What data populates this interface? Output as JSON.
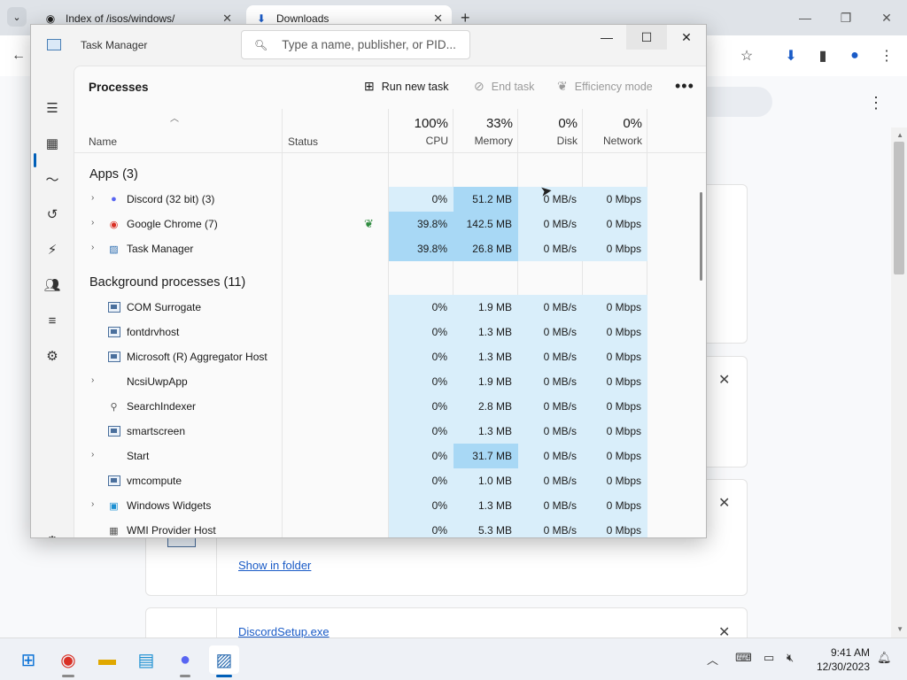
{
  "browser": {
    "tabs": [
      {
        "title": "Index of /isos/windows/",
        "icon": "web-page-icon",
        "active": false
      },
      {
        "title": "Downloads",
        "icon": "download-icon",
        "active": true
      }
    ],
    "downloads": {
      "show_in_folder": "Show in folder",
      "file_link": "DiscordSetup.exe"
    }
  },
  "taskmanager": {
    "title": "Task Manager",
    "search_placeholder": "Type a name, publisher, or PID...",
    "page_title": "Processes",
    "commands": {
      "run_new_task": "Run new task",
      "end_task": "End task",
      "efficiency_mode": "Efficiency mode",
      "more": "•••"
    },
    "columns": {
      "name": "Name",
      "status": "Status",
      "cpu": {
        "pct": "100%",
        "label": "CPU"
      },
      "memory": {
        "pct": "33%",
        "label": "Memory"
      },
      "disk": {
        "pct": "0%",
        "label": "Disk"
      },
      "network": {
        "pct": "0%",
        "label": "Network"
      }
    },
    "groups": {
      "apps": "Apps (3)",
      "background": "Background processes (11)"
    },
    "apps": [
      {
        "name": "Discord (32 bit) (3)",
        "icon": "discord-icon",
        "expandable": true,
        "cpu": "0%",
        "memory": "51.2 MB",
        "disk": "0 MB/s",
        "network": "0 Mbps"
      },
      {
        "name": "Google Chrome (7)",
        "icon": "chrome-icon",
        "expandable": true,
        "eco": true,
        "cpu": "39.8%",
        "memory": "142.5 MB",
        "disk": "0 MB/s",
        "network": "0 Mbps"
      },
      {
        "name": "Task Manager",
        "icon": "task-manager-icon",
        "expandable": true,
        "cpu": "39.8%",
        "memory": "26.8 MB",
        "disk": "0 MB/s",
        "network": "0 Mbps"
      }
    ],
    "background": [
      {
        "name": "COM Surrogate",
        "icon": "window-app-icon",
        "expandable": false,
        "cpu": "0%",
        "memory": "1.9 MB",
        "disk": "0 MB/s",
        "network": "0 Mbps"
      },
      {
        "name": "fontdrvhost",
        "icon": "window-app-icon",
        "expandable": false,
        "cpu": "0%",
        "memory": "1.3 MB",
        "disk": "0 MB/s",
        "network": "0 Mbps"
      },
      {
        "name": "Microsoft (R) Aggregator Host",
        "icon": "window-app-icon",
        "expandable": false,
        "cpu": "0%",
        "memory": "1.3 MB",
        "disk": "0 MB/s",
        "network": "0 Mbps"
      },
      {
        "name": "NcsiUwpApp",
        "icon": "blank-app-icon",
        "expandable": true,
        "cpu": "0%",
        "memory": "1.9 MB",
        "disk": "0 MB/s",
        "network": "0 Mbps"
      },
      {
        "name": "SearchIndexer",
        "icon": "search-indexer-icon",
        "expandable": false,
        "cpu": "0%",
        "memory": "2.8 MB",
        "disk": "0 MB/s",
        "network": "0 Mbps"
      },
      {
        "name": "smartscreen",
        "icon": "window-app-icon",
        "expandable": false,
        "cpu": "0%",
        "memory": "1.3 MB",
        "disk": "0 MB/s",
        "network": "0 Mbps"
      },
      {
        "name": "Start",
        "icon": "blank-app-icon",
        "expandable": true,
        "cpu": "0%",
        "memory": "31.7 MB",
        "disk": "0 MB/s",
        "network": "0 Mbps"
      },
      {
        "name": "vmcompute",
        "icon": "window-app-icon",
        "expandable": false,
        "cpu": "0%",
        "memory": "1.0 MB",
        "disk": "0 MB/s",
        "network": "0 Mbps"
      },
      {
        "name": "Windows Widgets",
        "icon": "widgets-icon",
        "expandable": true,
        "cpu": "0%",
        "memory": "1.3 MB",
        "disk": "0 MB/s",
        "network": "0 Mbps"
      },
      {
        "name": "WMI Provider Host",
        "icon": "wmi-icon",
        "expandable": false,
        "cpu": "0%",
        "memory": "5.3 MB",
        "disk": "0 MB/s",
        "network": "0 Mbps"
      }
    ]
  },
  "taskbar": {
    "time": "9:41 AM",
    "date": "12/30/2023"
  },
  "colors": {
    "accent": "#005fb8",
    "heat_low": "#d9eefa",
    "heat_mid": "#bfe3f7",
    "heat_high": "#a8d8f5",
    "link": "#1a5bc7"
  }
}
